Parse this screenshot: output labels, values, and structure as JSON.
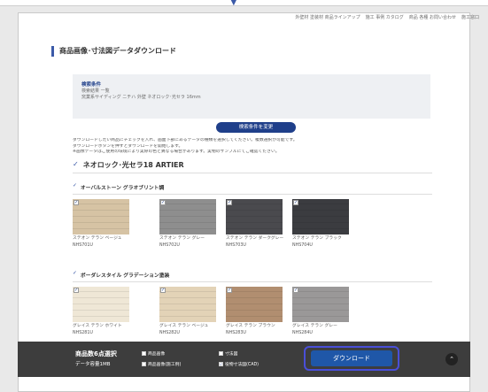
{
  "header": {
    "nav": [
      "外壁材 塗装材 商品ラインアップ",
      "施工 事例 カタログ",
      "商品 各種 お問い合わせ",
      "施工窓口"
    ],
    "title": "商品画像･寸法図データダウンロード"
  },
  "conditions": {
    "title": "検索条件",
    "lines": [
      "検索結果 一覧",
      "窯業系サイディング ニチハ 外壁 ネオロック･光セラ 16mm"
    ]
  },
  "change_button": "検索条件を変更",
  "notes": [
    "ダウンロードしたい商品にチェックを入れ、画面下部にあるデータの種類を選択してください。複数選択が可能です。",
    "ダウンロードボタンを押すとダウンロードを開始します。",
    "※画像データはご使用の環境により実際の色と異なる場合があります。実物のサンプルにてご確認ください。"
  ],
  "series": {
    "check": "✓",
    "name": "ネオロック･光セラ18 ARTIER"
  },
  "sections": [
    {
      "title": "オーバルストーン グラオブリント調",
      "items": [
        {
          "name": "ステオン テラン ベージュ",
          "code": "NHS701U",
          "color": "#d6c3a4"
        },
        {
          "name": "ステオン テラン グレー",
          "code": "NHS702U",
          "color": "#8e8e8e"
        },
        {
          "name": "ステオン テラン ダークグレー",
          "code": "NHS703U",
          "color": "#4a4a4e"
        },
        {
          "name": "ステオン テラン ブラック",
          "code": "NHS704U",
          "color": "#3b3c40"
        }
      ]
    },
    {
      "title": "ボーダレスタイル グラデーション塗装",
      "items": [
        {
          "name": "グレイス テラン ホワイト",
          "code": "NHS281U",
          "color": "#efe7d6"
        },
        {
          "name": "グレイス テラン ベージュ",
          "code": "NHS282U",
          "color": "#e3d3b7"
        },
        {
          "name": "グレイス テラン ブラウン",
          "code": "NHS283U",
          "color": "#b18e70"
        },
        {
          "name": "グレイス テラン グレー",
          "code": "NHS284U",
          "color": "#9a9898"
        }
      ]
    }
  ],
  "footer": {
    "selected": "商品数6点選択",
    "capacity": "データ容量1MB",
    "options": [
      {
        "label": "商品画像",
        "checked": false
      },
      {
        "label": "商品画像(施工例)",
        "checked": false
      },
      {
        "label": "寸法図",
        "checked": false
      },
      {
        "label": "役物寸法図(CAD)",
        "checked": true
      }
    ],
    "download": "ダウンロード",
    "to_top": "⌃"
  }
}
